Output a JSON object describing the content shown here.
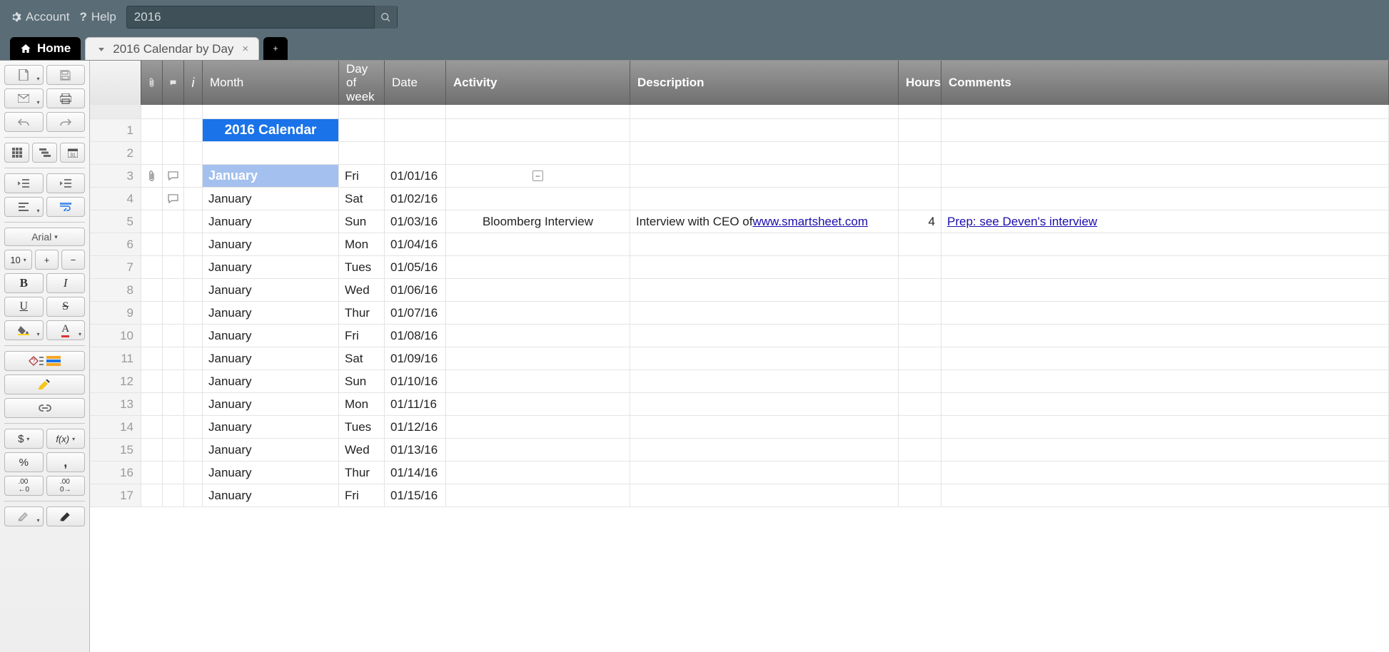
{
  "topbar": {
    "account": "Account",
    "help": "Help",
    "search_value": "2016"
  },
  "tabs": {
    "home": "Home",
    "sheet": "2016 Calendar by Day"
  },
  "columns": {
    "month": "Month",
    "dow": "Day of week",
    "date": "Date",
    "activity": "Activity",
    "description": "Description",
    "hours": "Hours",
    "comments": "Comments",
    "info": "i"
  },
  "font": {
    "name": "Arial",
    "size": "10"
  },
  "title_cell": "2016 Calendar",
  "rows": [
    {
      "n": 1,
      "title": true
    },
    {
      "n": 2
    },
    {
      "n": 3,
      "month_hdr": true,
      "month": "January",
      "dow": "Fri",
      "date": "01/01/16",
      "attach": true,
      "comment": true,
      "collapse": true
    },
    {
      "n": 4,
      "month": "January",
      "dow": "Sat",
      "date": "01/02/16",
      "comment": true
    },
    {
      "n": 5,
      "month": "January",
      "dow": "Sun",
      "date": "01/03/16",
      "activity": "Bloomberg Interview",
      "desc_pre": "Interview with CEO of ",
      "desc_link": "www.smartsheet.com",
      "hours": "4",
      "comments_link": "Prep: see Deven's interview"
    },
    {
      "n": 6,
      "month": "January",
      "dow": "Mon",
      "date": "01/04/16"
    },
    {
      "n": 7,
      "month": "January",
      "dow": "Tues",
      "date": "01/05/16"
    },
    {
      "n": 8,
      "month": "January",
      "dow": "Wed",
      "date": "01/06/16"
    },
    {
      "n": 9,
      "month": "January",
      "dow": "Thur",
      "date": "01/07/16"
    },
    {
      "n": 10,
      "month": "January",
      "dow": "Fri",
      "date": "01/08/16"
    },
    {
      "n": 11,
      "month": "January",
      "dow": "Sat",
      "date": "01/09/16"
    },
    {
      "n": 12,
      "month": "January",
      "dow": "Sun",
      "date": "01/10/16"
    },
    {
      "n": 13,
      "month": "January",
      "dow": "Mon",
      "date": "01/11/16"
    },
    {
      "n": 14,
      "month": "January",
      "dow": "Tues",
      "date": "01/12/16"
    },
    {
      "n": 15,
      "month": "January",
      "dow": "Wed",
      "date": "01/13/16"
    },
    {
      "n": 16,
      "month": "January",
      "dow": "Thur",
      "date": "01/14/16"
    },
    {
      "n": 17,
      "month": "January",
      "dow": "Fri",
      "date": "01/15/16"
    }
  ],
  "toolbar_labels": {
    "currency": "$",
    "percent": "%",
    "comma": ",",
    "dec_inc": ".00→",
    "dec_dec": "←.00",
    "bold": "B",
    "italic": "I",
    "underline": "U",
    "strike": "S",
    "plus": "+",
    "minus": "−",
    "fx": "f(x)"
  }
}
